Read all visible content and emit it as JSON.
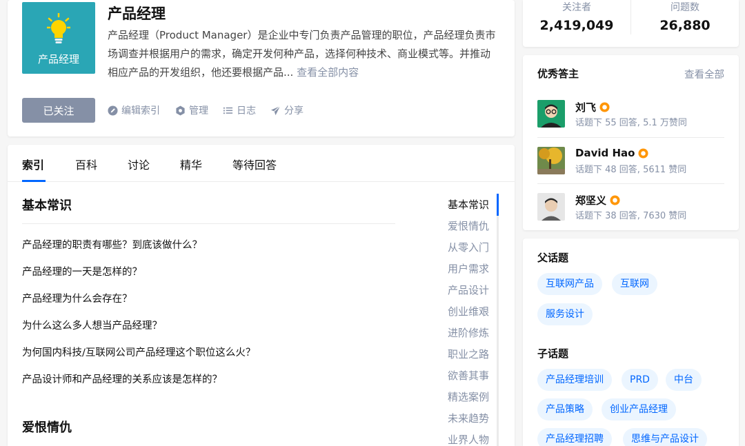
{
  "topic": {
    "logo_text": "产品经理",
    "title": "产品经理",
    "description": "产品经理（Product Manager）是企业中专门负责产品管理的职位，产品经理负责市场调查并根据用户的需求，确定开发何种产品，选择何种技术、商业模式等。并推动相应产品的开发组织，他还要根据产品...",
    "see_more": "查看全部内容",
    "follow_label": "已关注",
    "actions": {
      "edit_index": "编辑索引",
      "manage": "管理",
      "log": "日志",
      "share": "分享"
    }
  },
  "tabs": [
    "索引",
    "百科",
    "讨论",
    "精华",
    "等待回答"
  ],
  "main": {
    "section1_title": "基本常识",
    "questions": [
      "产品经理的职责有哪些？到底该做什么？",
      "产品经理的一天是怎样的？",
      "产品经理为什么会存在？",
      "为什么这么多人想当产品经理？",
      "为何国内科技/互联网公司产品经理这个职位这么火？",
      "产品设计师和产品经理的关系应该是怎样的？"
    ],
    "section2_title": "爱恨情仇",
    "side_nav": [
      "基本常识",
      "爱恨情仇",
      "从零入门",
      "用户需求",
      "产品设计",
      "创业维艰",
      "进阶修炼",
      "职业之路",
      "欲善其事",
      "精选案例",
      "未来趋势",
      "业界人物"
    ]
  },
  "stats": {
    "followers_label": "关注者",
    "followers_value": "2,419,049",
    "questions_label": "问题数",
    "questions_value": "26,880"
  },
  "answerers": {
    "title": "优秀答主",
    "see_all": "查看全部",
    "items": [
      {
        "name": "刘飞",
        "stats": "话题下 55 回答, 5.1 万赞同"
      },
      {
        "name": "David Hao",
        "stats": "话题下 48 回答, 5611 赞同"
      },
      {
        "name": "郑坚义",
        "stats": "话题下 38 回答, 7630 赞同"
      }
    ]
  },
  "related": {
    "parent_title": "父话题",
    "parents": [
      "互联网产品",
      "互联网",
      "服务设计"
    ],
    "child_title": "子话题",
    "children": [
      "产品经理培训",
      "PRD",
      "中台",
      "产品策略",
      "创业产品经理",
      "产品经理招聘",
      "思维与产品设计"
    ]
  },
  "colors": {
    "accent": "#0066ff",
    "logo_bg": "#2aa6b5",
    "muted": "#8590a6",
    "badge": "#ff9607"
  }
}
